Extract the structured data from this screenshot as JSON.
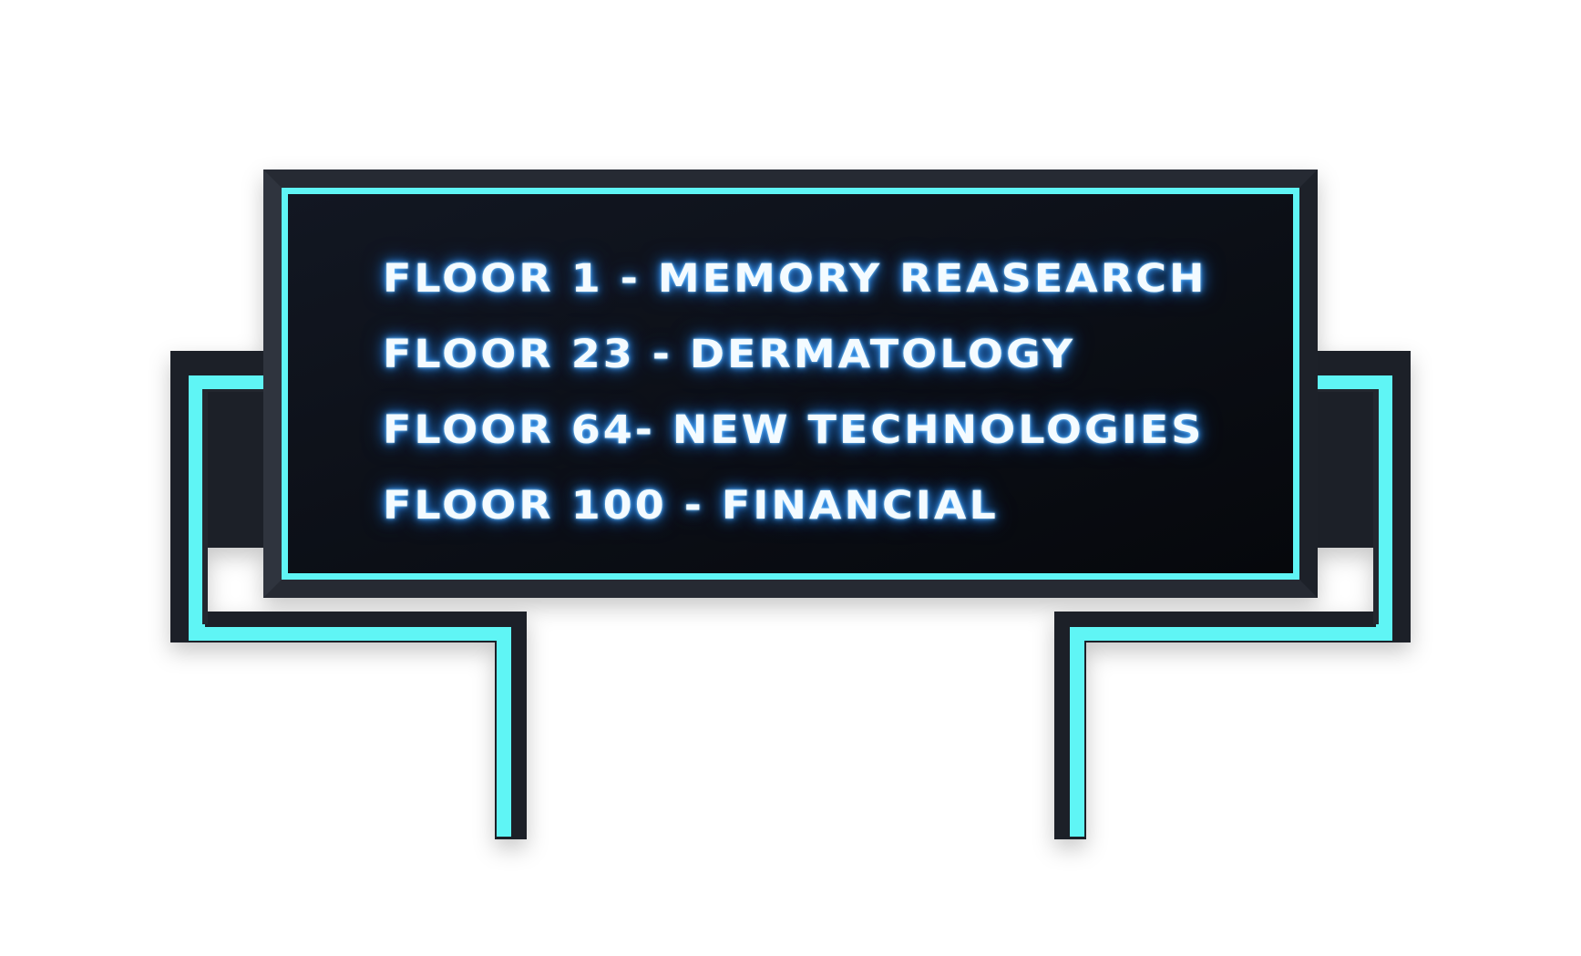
{
  "sign": {
    "lines": [
      "FLOOR 1 - MEMORY REASEARCH",
      "FLOOR 23 - DERMATOLOGY",
      "FLOOR 64- NEW TECHNOLOGIES",
      "FLOOR 100 - FINANCIAL"
    ]
  },
  "colors": {
    "background": "#ffffff",
    "panel": "#0b0e13",
    "frame": "#262a33",
    "neon_trim": "#5ff5f5",
    "text": "#f4fbff",
    "glow": "#3fa3ff"
  }
}
